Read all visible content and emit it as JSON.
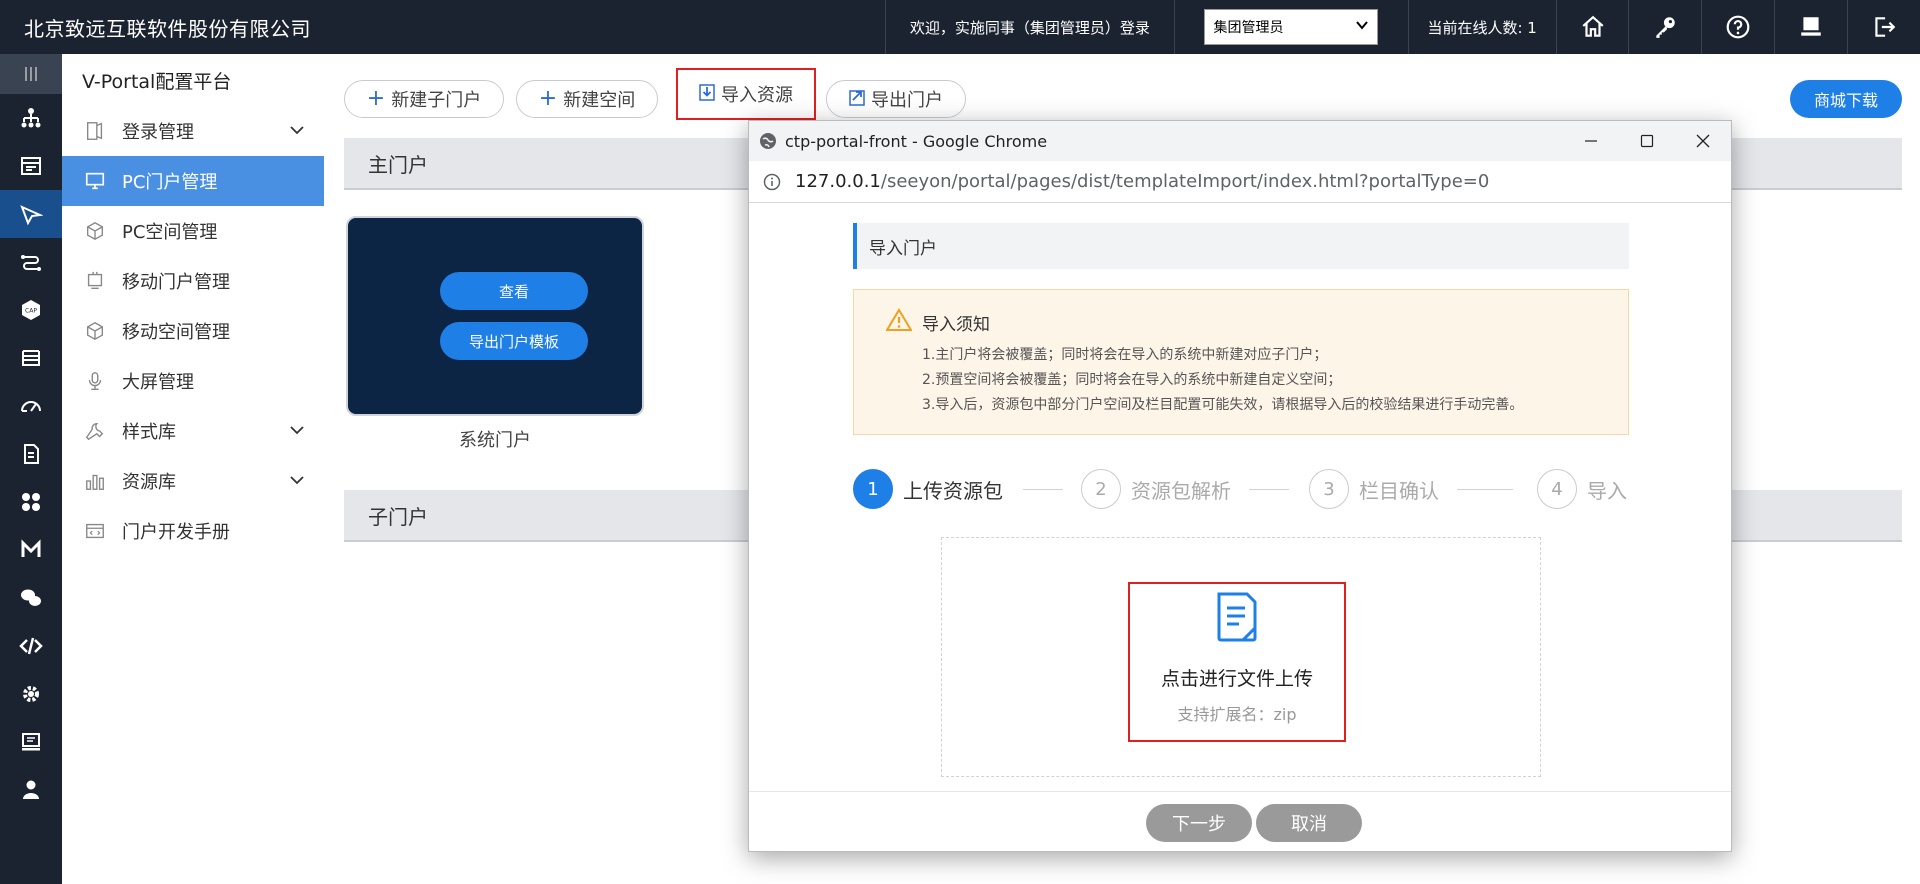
{
  "topbar": {
    "company": "北京致远互联软件股份有限公司",
    "welcome": "欢迎，实施同事（集团管理员）登录",
    "role_select": "集团管理员",
    "online": "当前在线人数: 1"
  },
  "sidebar": {
    "title": "V-Portal配置平台",
    "items": [
      {
        "label": "登录管理"
      },
      {
        "label": "PC门户管理"
      },
      {
        "label": "PC空间管理"
      },
      {
        "label": "移动门户管理"
      },
      {
        "label": "移动空间管理"
      },
      {
        "label": "大屏管理"
      },
      {
        "label": "样式库"
      },
      {
        "label": "资源库"
      },
      {
        "label": "门户开发手册"
      }
    ]
  },
  "toolbar": {
    "new_sub_portal": "新建子门户",
    "new_space": "新建空间",
    "import_resource": "导入资源",
    "export_portal": "导出门户",
    "store_download": "商城下载"
  },
  "main": {
    "main_portal_section": "主门户",
    "sub_portal_section": "子门户",
    "portal_card": {
      "view_button": "查看",
      "export_template_button": "导出门户模板",
      "name": "系统门户"
    }
  },
  "dialog": {
    "window_title": "ctp-portal-front - Google Chrome",
    "url_host": "127.0.0.1",
    "url_path": "/seeyon/portal/pages/dist/templateImport/index.html?portalType=0",
    "header": "导入门户",
    "notice": {
      "title": "导入须知",
      "lines": [
        "1.主门户将会被覆盖；同时将会在导入的系统中新建对应子门户；",
        "2.预置空间将会被覆盖；同时将会在导入的系统中新建自定义空间；",
        "3.导入后，资源包中部分门户空间及栏目配置可能失效，请根据导入后的校验结果进行手动完善。"
      ]
    },
    "steps": [
      {
        "num": "1",
        "label": "上传资源包"
      },
      {
        "num": "2",
        "label": "资源包解析"
      },
      {
        "num": "3",
        "label": "栏目确认"
      },
      {
        "num": "4",
        "label": "导入"
      }
    ],
    "upload": {
      "title": "点击进行文件上传",
      "hint": "支持扩展名：zip"
    },
    "next_button": "下一步",
    "cancel_button": "取消"
  }
}
